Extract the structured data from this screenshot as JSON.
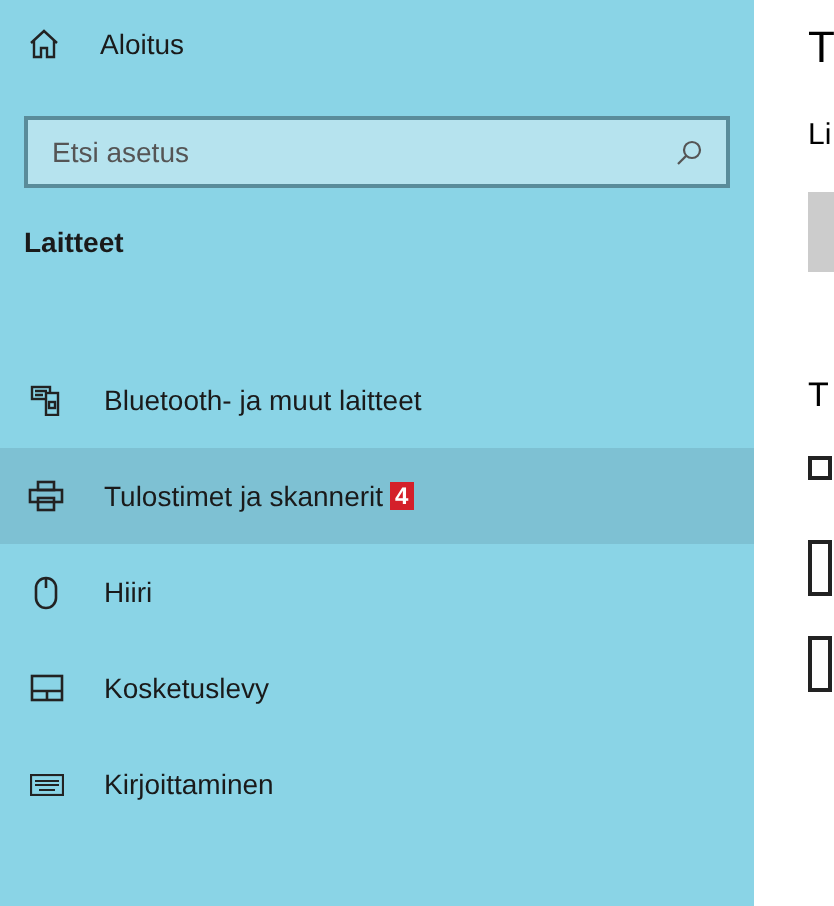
{
  "sidebar": {
    "home": {
      "label": "Aloitus"
    },
    "search": {
      "placeholder": "Etsi asetus"
    },
    "section_title": "Laitteet",
    "items": [
      {
        "label": "Bluetooth- ja muut laitteet",
        "selected": false
      },
      {
        "label": "Tulostimet ja skannerit",
        "selected": true,
        "badge": "4"
      },
      {
        "label": "Hiiri",
        "selected": false
      },
      {
        "label": "Kosketuslevy",
        "selected": false
      },
      {
        "label": "Kirjoittaminen",
        "selected": false
      }
    ]
  },
  "content": {
    "title": "T",
    "description": "Li",
    "subheading": "T"
  }
}
